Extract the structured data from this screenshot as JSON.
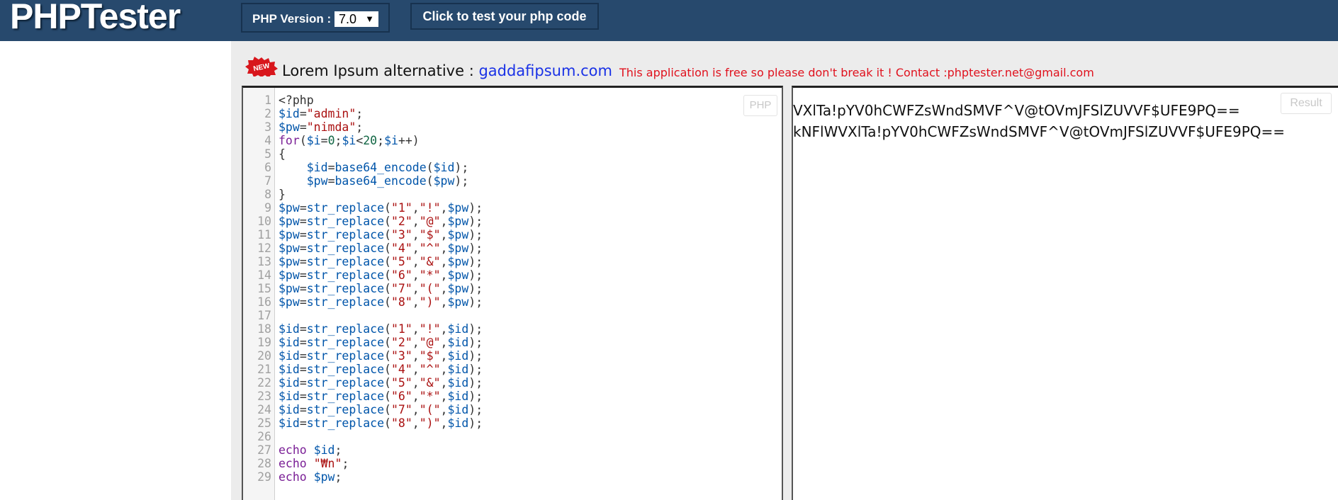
{
  "header": {
    "logo": "PHPTester",
    "version_label": "PHP Version :",
    "version_selected": "7.0",
    "test_button": "Click to test your php code"
  },
  "announcement": {
    "badge": "NEW",
    "lorem_text": "Lorem Ipsum alternative : ",
    "lorem_link": "gaddafipsum.com",
    "notice": "This application is free so please don't break it ! Contact :phptester.net@gmail.com"
  },
  "editor": {
    "corner_label": "PHP",
    "line_numbers": [
      "1",
      "2",
      "3",
      "4",
      "5",
      "6",
      "7",
      "8",
      "9",
      "10",
      "11",
      "12",
      "13",
      "14",
      "15",
      "16",
      "17",
      "18",
      "19",
      "20",
      "21",
      "22",
      "23",
      "24",
      "25",
      "26",
      "27",
      "28",
      "29"
    ],
    "lines": [
      "<?php",
      "$id=\"admin\";",
      "$pw=\"nimda\";",
      "for($i=0;$i<20;$i++)",
      "{",
      "    $id=base64_encode($id);",
      "    $pw=base64_encode($pw);",
      "}",
      "$pw=str_replace(\"1\",\"!\",$pw);",
      "$pw=str_replace(\"2\",\"@\",$pw);",
      "$pw=str_replace(\"3\",\"$\",$pw);",
      "$pw=str_replace(\"4\",\"^\",$pw);",
      "$pw=str_replace(\"5\",\"&\",$pw);",
      "$pw=str_replace(\"6\",\"*\",$pw);",
      "$pw=str_replace(\"7\",\"(\",$pw);",
      "$pw=str_replace(\"8\",\")\",$pw);",
      "",
      "$id=str_replace(\"1\",\"!\",$id);",
      "$id=str_replace(\"2\",\"@\",$id);",
      "$id=str_replace(\"3\",\"$\",$id);",
      "$id=str_replace(\"4\",\"^\",$id);",
      "$id=str_replace(\"5\",\"&\",$id);",
      "$id=str_replace(\"6\",\"*\",$id);",
      "$id=str_replace(\"7\",\"(\",$id);",
      "$id=str_replace(\"8\",\")\",$id);",
      "",
      "echo $id;",
      "echo \"₩n\";",
      "echo $pw;"
    ]
  },
  "result": {
    "corner_label": "Result",
    "lines": [
      "VXlTa!pYV0hCWFZsWndSMVF^V@tOVmJFSlZUVVF$UFE9PQ==",
      "kNFlWVXlTa!pYV0hCWFZsWndSMVF^V@tOVmJFSlZUVVF$UFE9PQ=="
    ]
  },
  "colors": {
    "header_bg": "#27496d",
    "notice": "#e0111d",
    "link": "#1a32e6"
  }
}
